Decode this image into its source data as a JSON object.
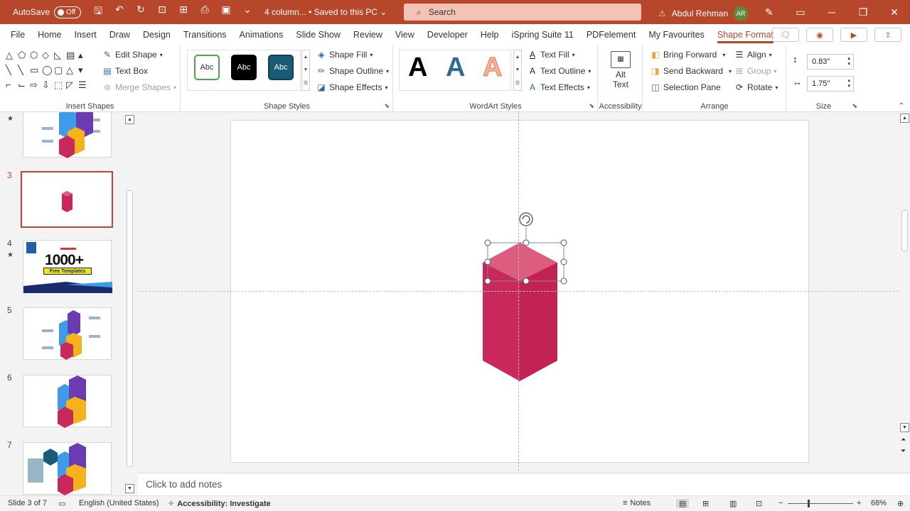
{
  "titlebar": {
    "autosave_label": "AutoSave",
    "autosave_state": "Off",
    "doc_title": "4 column... • Saved to this PC ⌄",
    "search_placeholder": "Search",
    "user_name": "Abdul Rehman",
    "user_initials": "AR",
    "accent": "#b7472a"
  },
  "tabs": [
    {
      "label": "File"
    },
    {
      "label": "Home"
    },
    {
      "label": "Insert"
    },
    {
      "label": "Draw"
    },
    {
      "label": "Design"
    },
    {
      "label": "Transitions"
    },
    {
      "label": "Animations"
    },
    {
      "label": "Slide Show"
    },
    {
      "label": "Review"
    },
    {
      "label": "View"
    },
    {
      "label": "Developer"
    },
    {
      "label": "Help"
    },
    {
      "label": "iSpring Suite 11"
    },
    {
      "label": "PDFelement"
    },
    {
      "label": "My Favourites"
    },
    {
      "label": "Shape Format"
    }
  ],
  "ribbon": {
    "insert_shapes": {
      "label": "Insert Shapes",
      "edit_shape": "Edit Shape",
      "text_box": "Text Box",
      "merge_shapes": "Merge Shapes"
    },
    "shape_styles": {
      "label": "Shape Styles",
      "preset_text": "Abc",
      "shape_fill": "Shape Fill",
      "shape_outline": "Shape Outline",
      "shape_effects": "Shape Effects"
    },
    "wordart": {
      "label": "WordArt Styles",
      "letter": "A",
      "text_fill": "Text Fill",
      "text_outline": "Text Outline",
      "text_effects": "Text Effects"
    },
    "accessibility": {
      "label": "Accessibility",
      "alt_text_line1": "Alt",
      "alt_text_line2": "Text"
    },
    "arrange": {
      "label": "Arrange",
      "bring_forward": "Bring Forward",
      "send_backward": "Send Backward",
      "selection_pane": "Selection Pane",
      "align": "Align",
      "group": "Group",
      "rotate": "Rotate"
    },
    "size": {
      "label": "Size",
      "height": "0.83\"",
      "width": "1.75\""
    }
  },
  "thumbnails": [
    {
      "num": "",
      "star": true
    },
    {
      "num": "3",
      "star": false
    },
    {
      "num": "4",
      "star": true,
      "headline": "1000+",
      "subline": "Free Templates"
    },
    {
      "num": "5",
      "star": false
    },
    {
      "num": "6",
      "star": false
    },
    {
      "num": "7",
      "star": false
    }
  ],
  "notes_placeholder": "Click to add notes",
  "statusbar": {
    "slide_info": "Slide 3 of 7",
    "language": "English (United States)",
    "accessibility": "Accessibility: Investigate",
    "notes": "Notes",
    "zoom": "68%"
  },
  "colors": {
    "box_front": "#c9285a",
    "box_top": "#db5d80",
    "selection_handle": "#666666"
  }
}
